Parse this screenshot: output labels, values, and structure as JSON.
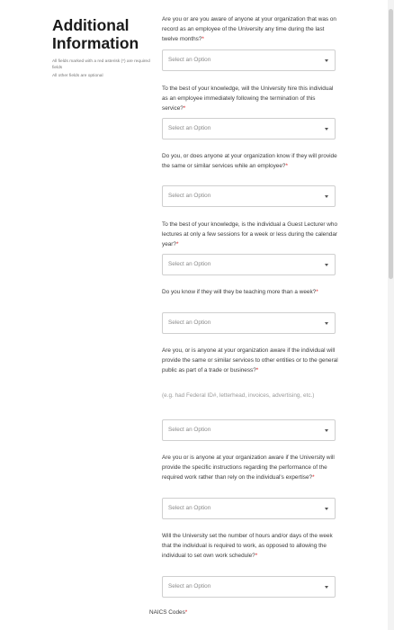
{
  "sidebar": {
    "title_line1": "Additional",
    "title_line2": "Information",
    "note1": "All fields marked with a red asterisk (*) are required fields",
    "note2": "All other fields are optional"
  },
  "required_mark": "*",
  "questions": [
    {
      "text": "Are you or are you aware of anyone at your organization that was on record as an employee of the University any time during the last twelve months?",
      "placeholder": "Select an Option"
    },
    {
      "text": "To the best of your knowledge, will the University hire this individual as an employee immediately following the termination of this service?",
      "placeholder": "Select an Option"
    },
    {
      "text": "Do you, or does anyone at your organization know if they will provide the same or similar services while an employee?",
      "placeholder": "Select an Option"
    },
    {
      "text": "To the best of your knowledge, is the individual a Guest Lecturer who lectures at only a few sessions for a week or less during the calendar year?",
      "placeholder": "Select an Option"
    },
    {
      "text": "Do you know if they will they be teaching more than a week?",
      "placeholder": "Select an Option"
    },
    {
      "text": "Are you, or is anyone at your organization aware if the individual will provide the same or similar services to other entities or to the general public as part of a trade or business?",
      "hint": "(e.g. had Federal ID#, letterhead, invoices, advertising, etc.)",
      "placeholder": "Select an Option"
    },
    {
      "text": "Are you or is anyone at your organization aware if the University will provide the specific instructions regarding the performance of the required work rather than rely on the individual's expertise?",
      "placeholder": "Select an Option"
    },
    {
      "text": "Will the University set the number of hours and/or days of the week that the individual is required to work, as opposed to allowing the individual to set own work schedule?",
      "placeholder": "Select an Option"
    }
  ],
  "naics_label": "NAICS Codes"
}
